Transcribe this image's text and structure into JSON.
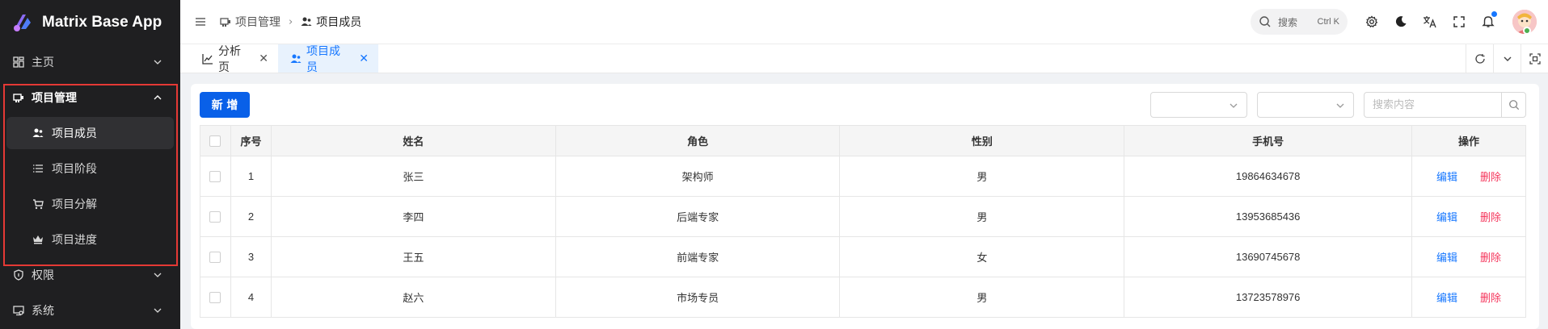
{
  "app": {
    "name": "Matrix Base App"
  },
  "sidebar": {
    "items": [
      {
        "label": "主页",
        "icon": "dashboard-icon",
        "expanded": false
      },
      {
        "label": "项目管理",
        "icon": "project-icon",
        "expanded": true,
        "children": [
          {
            "label": "项目成员",
            "icon": "user-group-icon",
            "active": true
          },
          {
            "label": "项目阶段",
            "icon": "list-icon",
            "active": false
          },
          {
            "label": "项目分解",
            "icon": "cart-icon",
            "active": false
          },
          {
            "label": "项目进度",
            "icon": "crown-icon",
            "active": false
          }
        ]
      },
      {
        "label": "权限",
        "icon": "shield-icon",
        "expanded": false
      },
      {
        "label": "系统",
        "icon": "system-icon",
        "expanded": false
      }
    ]
  },
  "header": {
    "breadcrumb": [
      {
        "label": "项目管理",
        "icon": "project-icon"
      },
      {
        "label": "项目成员",
        "icon": "user-group-icon"
      }
    ],
    "search": {
      "label": "搜索",
      "shortcut": "Ctrl K"
    }
  },
  "tabs": [
    {
      "label": "分析页",
      "icon": "chart-icon",
      "active": false
    },
    {
      "label": "项目成员",
      "icon": "user-group-icon",
      "active": true
    }
  ],
  "toolbar": {
    "add_label": "新 增",
    "search_placeholder": "搜索内容"
  },
  "table": {
    "columns": [
      "序号",
      "姓名",
      "角色",
      "性别",
      "手机号",
      "操作"
    ],
    "rows": [
      {
        "index": "1",
        "name": "张三",
        "role": "架构师",
        "gender": "男",
        "phone": "19864634678"
      },
      {
        "index": "2",
        "name": "李四",
        "role": "后端专家",
        "gender": "男",
        "phone": "13953685436"
      },
      {
        "index": "3",
        "name": "王五",
        "role": "前端专家",
        "gender": "女",
        "phone": "13690745678"
      },
      {
        "index": "4",
        "name": "赵六",
        "role": "市场专员",
        "gender": "男",
        "phone": "13723578976"
      }
    ],
    "edit_label": "编辑",
    "delete_label": "删除"
  },
  "colors": {
    "primary": "#0960e8",
    "danger": "#f5365c",
    "sidebar_bg": "#1f1f21",
    "highlight": "#e53935"
  }
}
